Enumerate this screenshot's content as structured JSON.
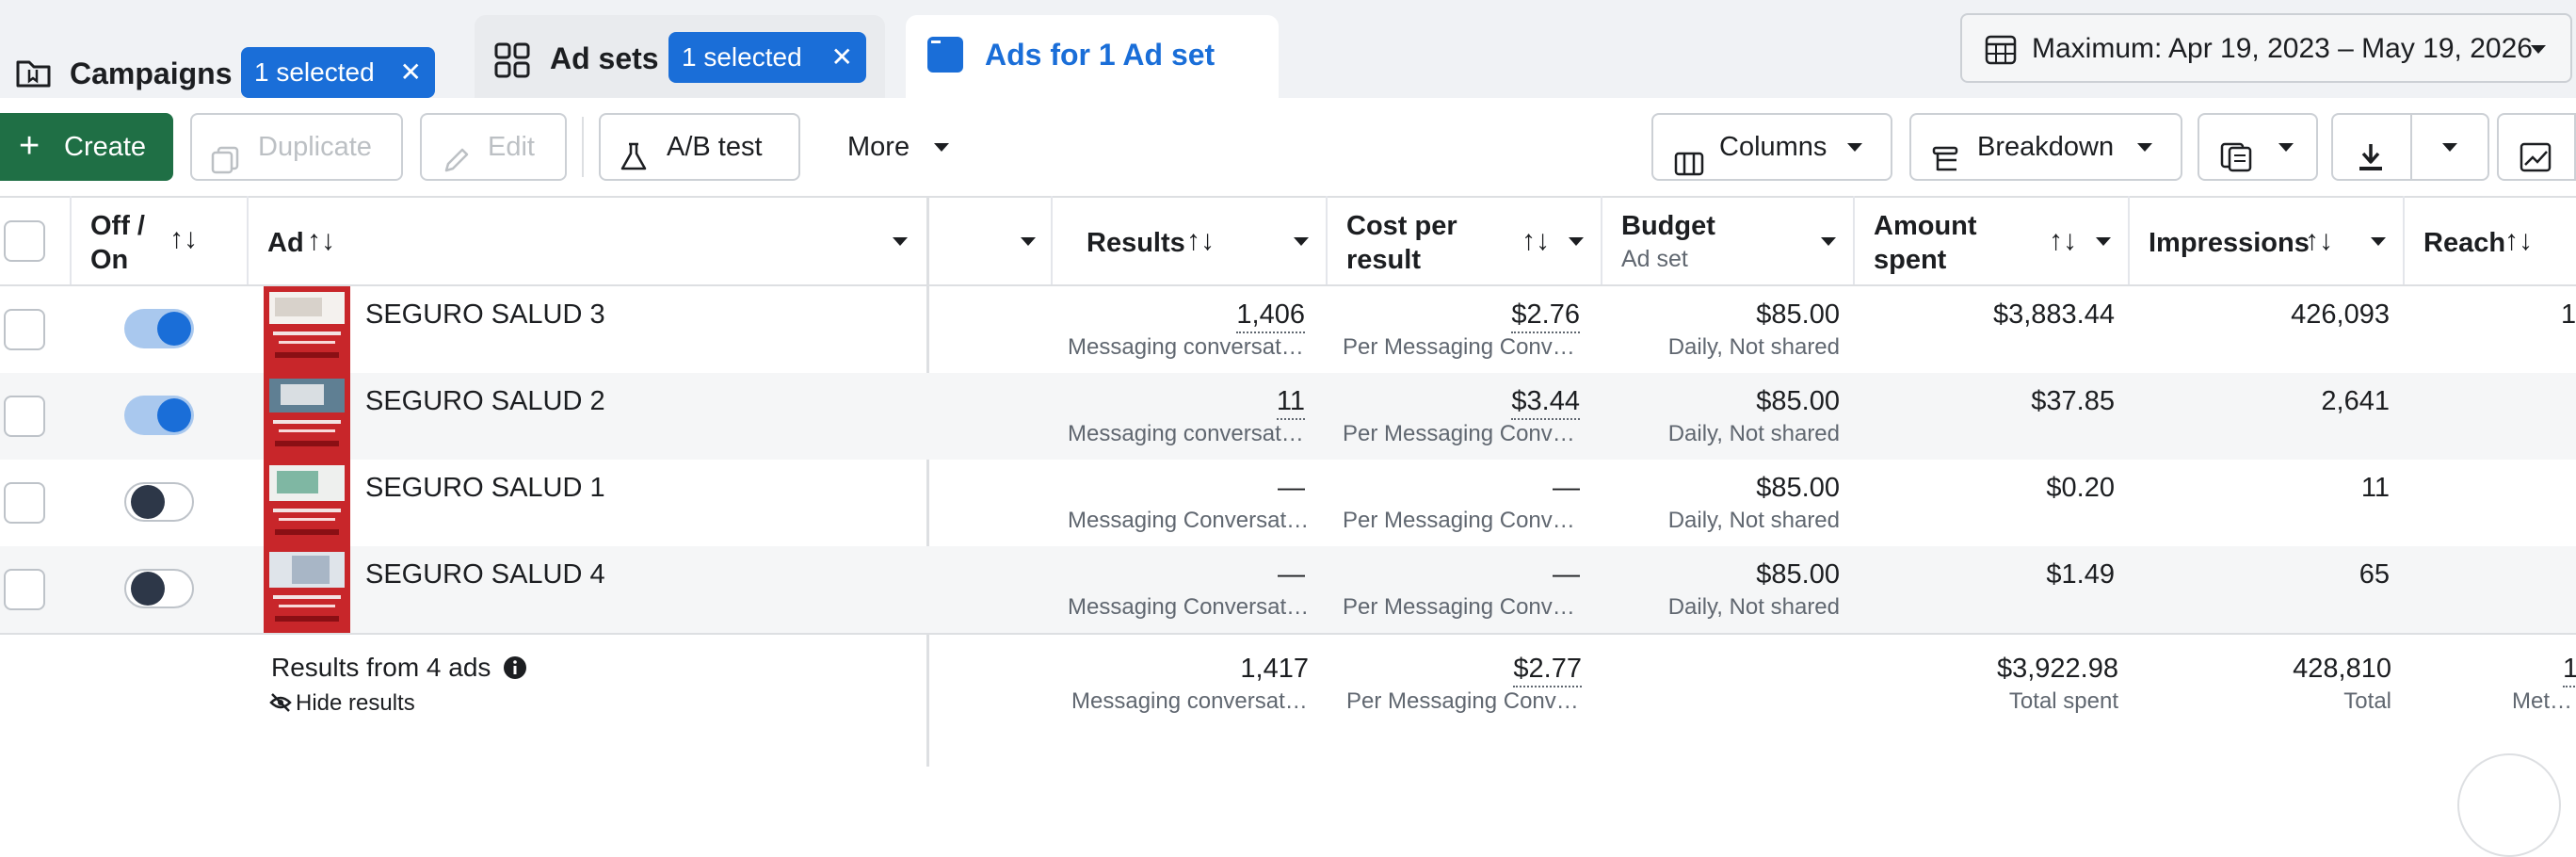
{
  "tabs": {
    "campaigns": {
      "label": "Campaigns",
      "selected_pill": "1 selected",
      "close": "✕"
    },
    "adsets": {
      "label": "Ad sets",
      "selected_pill": "1 selected",
      "close": "✕"
    },
    "ads": {
      "label": "Ads for 1 Ad set"
    }
  },
  "date_range": {
    "label": "Maximum: Apr 19, 2023 – May 19, 2026"
  },
  "toolbar": {
    "create": "Create",
    "duplicate": "Duplicate",
    "edit": "Edit",
    "ab_test": "A/B test",
    "more": "More",
    "columns": "Columns",
    "breakdown": "Breakdown"
  },
  "columns": {
    "off_on": "Off /\nOn",
    "off_on_line1": "Off /",
    "off_on_line2": "On",
    "ad": "Ad",
    "results": "Results",
    "cost_line1": "Cost per",
    "cost_line2": "result",
    "budget": "Budget",
    "budget_sub": "Ad set",
    "amount_line1": "Amount",
    "amount_line2": "spent",
    "impressions": "Impressions",
    "reach": "Reach",
    "sort_glyph": "↑↓"
  },
  "rows": [
    {
      "name": "SEGURO SALUD 3",
      "on": true,
      "results": "1,406",
      "results_sub": "Messaging conversat…",
      "cost": "$2.76",
      "cost_sub": "Per Messaging Conv…",
      "budget": "$85.00",
      "budget_sub": "Daily, Not shared",
      "spent": "$3,883.44",
      "impressions": "426,093",
      "reach": "1"
    },
    {
      "name": "SEGURO SALUD 2",
      "on": true,
      "results": "11",
      "results_sub": "Messaging conversat…",
      "cost": "$3.44",
      "cost_sub": "Per Messaging Conv…",
      "budget": "$85.00",
      "budget_sub": "Daily, Not shared",
      "spent": "$37.85",
      "impressions": "2,641",
      "reach": ""
    },
    {
      "name": "SEGURO SALUD 1",
      "on": false,
      "results": "—",
      "results_sub": "Messaging Conversati…",
      "cost": "—",
      "cost_sub": "Per Messaging Conve…",
      "budget": "$85.00",
      "budget_sub": "Daily, Not shared",
      "spent": "$0.20",
      "impressions": "11",
      "reach": ""
    },
    {
      "name": "SEGURO SALUD 4",
      "on": false,
      "results": "—",
      "results_sub": "Messaging Conversati…",
      "cost": "—",
      "cost_sub": "Per Messaging Conve…",
      "budget": "$85.00",
      "budget_sub": "Daily, Not shared",
      "spent": "$1.49",
      "impressions": "65",
      "reach": ""
    }
  ],
  "summary": {
    "title": "Results from 4 ads",
    "hide": "Hide results",
    "results": "1,417",
    "results_sub": "Messaging conversat…",
    "cost": "$2.77",
    "cost_sub": "Per Messaging Conv…",
    "spent": "$3,922.98",
    "spent_sub": "Total spent",
    "impressions": "428,810",
    "impressions_sub": "Total",
    "reach": "1",
    "reach_sub": "Meta A"
  },
  "colors": {
    "accent": "#1a6ed8",
    "create": "#1f6f45",
    "border": "#ccd0d5"
  }
}
